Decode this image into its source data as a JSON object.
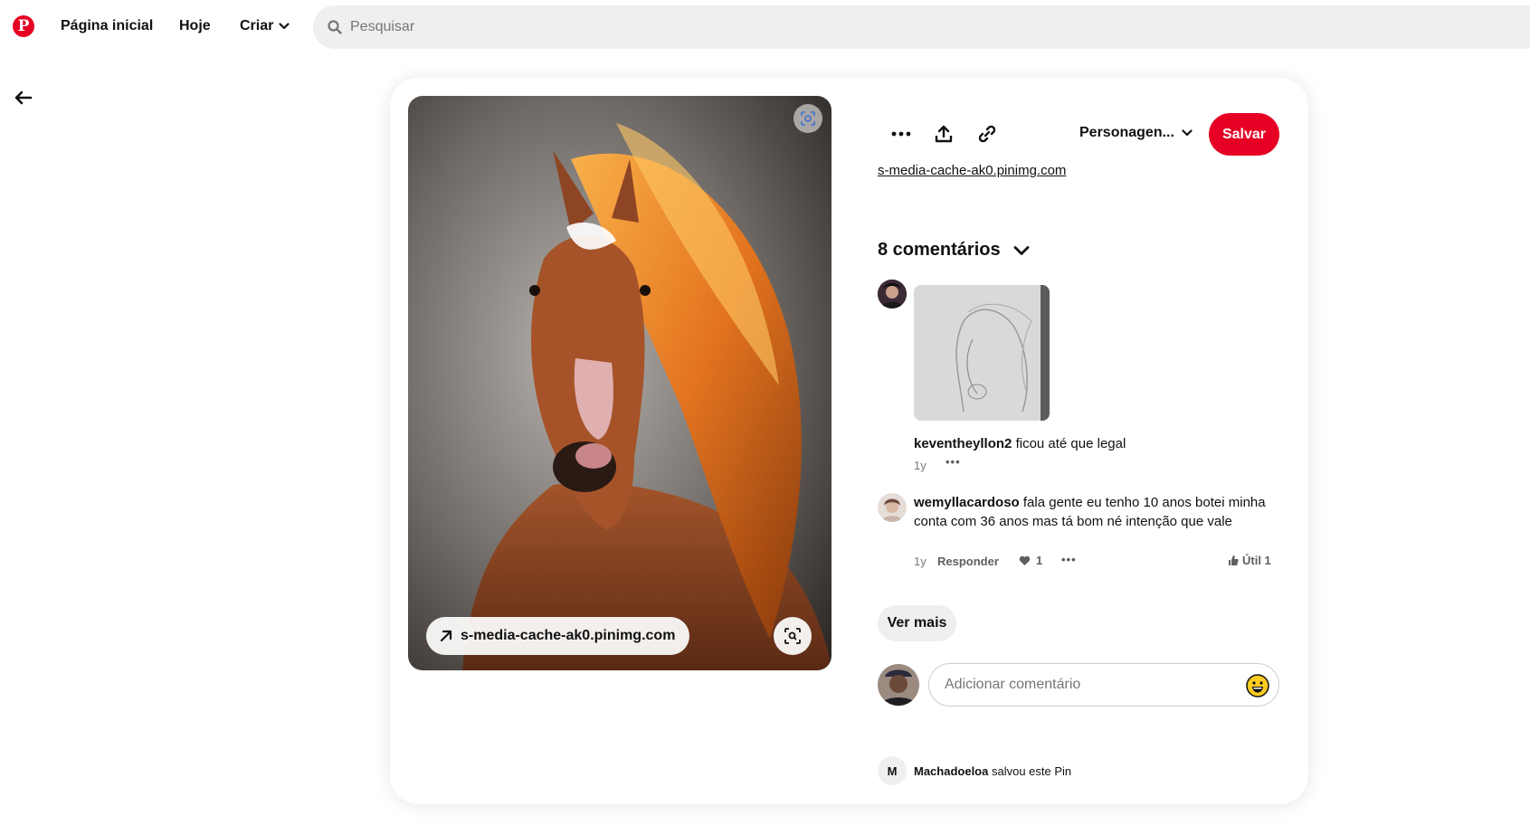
{
  "nav": {
    "home_label": "Página inicial",
    "today_label": "Hoje",
    "create_label": "Criar",
    "search_placeholder": "Pesquisar"
  },
  "pin": {
    "source_domain": "s-media-cache-ak0.pinimg.com",
    "source_link": "s-media-cache-ak0.pinimg.com",
    "board_name": "Personagen...",
    "save_label": "Salvar"
  },
  "comments": {
    "header": "8 comentários",
    "items": [
      {
        "author": "keventheyllon2",
        "text": "ficou até que legal",
        "time": "1y"
      },
      {
        "author": "wemyllacardoso",
        "text": "fala gente eu tenho 10 anos botei minha conta com 36 anos mas tá bom né intenção que vale",
        "time": "1y",
        "reply_label": "Responder",
        "likes": "1",
        "helpful_label": "Útil 1"
      }
    ],
    "see_more_label": "Ver mais",
    "add_placeholder": "Adicionar comentário"
  },
  "saved_by": {
    "initial": "M",
    "user": "Machadoeloa",
    "text": "salvou este Pin"
  },
  "colors": {
    "brand": "#e60023",
    "search_bg": "#efefef",
    "text": "#111111",
    "muted": "#767676"
  },
  "icons": [
    "pinterest-logo-icon",
    "chevron-down-icon",
    "search-icon",
    "arrow-left-icon",
    "visual-search-icon",
    "arrow-up-right-icon",
    "more-icon",
    "share-icon",
    "link-icon",
    "heart-icon",
    "thumb-icon",
    "emoji-icon"
  ]
}
